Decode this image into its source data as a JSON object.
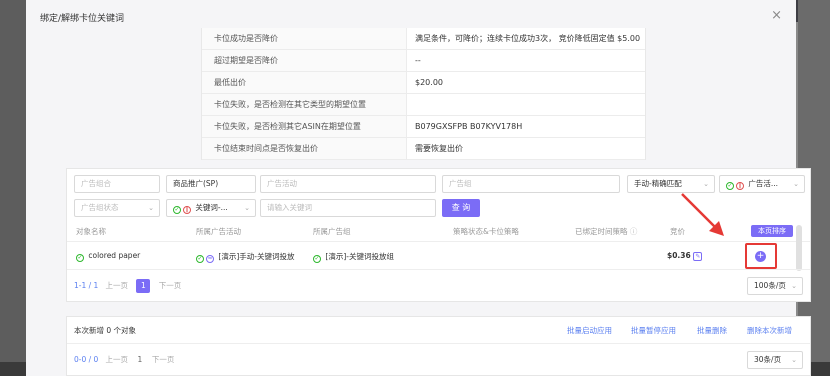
{
  "modal": {
    "title": "绑定/解绑卡位关键词",
    "close": "×"
  },
  "info_rows": [
    {
      "k": "卡位成功是否降价",
      "v": "满足条件，可降价；连续卡位成功3次，  竞价降低固定值 $5.00"
    },
    {
      "k": "超过期望是否降价",
      "v": "--"
    },
    {
      "k": "最低出价",
      "v": "$20.00"
    },
    {
      "k": "卡位失败，是否检测在其它类型的期望位置",
      "v": ""
    },
    {
      "k": "卡位失败，是否检测其它ASIN在期望位置",
      "v": "B079GXSFPB B07KYV178H"
    },
    {
      "k": "卡位结束时间点是否恢复出价",
      "v": "需要恢复出价"
    }
  ],
  "filters": {
    "ad_group_combo_ph": "广告组合",
    "ad_type": "商品推广(SP)",
    "campaign_ph": "广告活动",
    "ad_group_ph": "广告组",
    "match_type": "手动-精确匹配",
    "campaign_status": "广告活...",
    "ad_group_status_ph": "广告组状态",
    "keyword_status": "关键词-...",
    "keyword_input_ph": "请输入关键词",
    "query_btn": "查 询"
  },
  "table": {
    "headers": [
      "对象名称",
      "所属广告活动",
      "所属广告组",
      "策略状态&卡位策略",
      "已绑定时间策略",
      "竞价",
      "本页排序"
    ],
    "row": {
      "name": "colored paper",
      "campaign": "[演示]手动-关键词投放",
      "ad_group": "[演示]-关键词投放组",
      "bid": "$0.36"
    }
  },
  "pager1": {
    "range": "1-1 / 1",
    "prev": "上一页",
    "page": "1",
    "next": "下一页",
    "size": "100条/页"
  },
  "bottom": {
    "new_count": "本次新增 0 个对象",
    "actions": [
      "批量启动应用",
      "批量暂停应用",
      "批量删除",
      "删除本次新增"
    ]
  },
  "pager2": {
    "range": "0-0 / 0",
    "prev": "上一页",
    "page": "1",
    "next": "下一页",
    "size": "30条/页"
  },
  "colors": {
    "primary": "#7b6cf6",
    "highlight": "#e53935",
    "link": "#5a7ff0"
  }
}
